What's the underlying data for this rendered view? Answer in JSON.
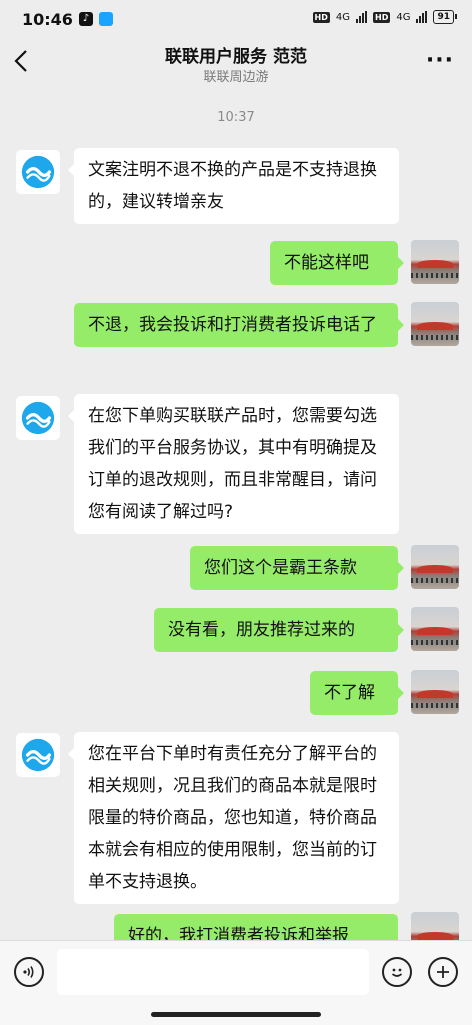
{
  "status_bar": {
    "time": "10:46",
    "battery": "91",
    "net1": "4G",
    "net2": "4G"
  },
  "header": {
    "title": "联联用户服务 范范",
    "subtitle": "联联周边游",
    "back_icon": "chevron-left-icon",
    "more_icon": "more-dots-icon"
  },
  "chat": {
    "timestamp": "10:37",
    "messages": [
      {
        "from": "service",
        "text": "文案注明不退不换的产品是不支持退换的，建议转增亲友"
      },
      {
        "from": "me",
        "text": "不能这样吧"
      },
      {
        "from": "me",
        "text": "不退，我会投诉和打消费者投诉电话了"
      },
      {
        "from": "service",
        "text": "在您下单购买联联产品时，您需要勾选我们的平台服务协议，其中有明确提及订单的退改规则，而且非常醒目，请问您有阅读了解过吗?"
      },
      {
        "from": "me",
        "text": "您们这个是霸王条款"
      },
      {
        "from": "me",
        "text": "没有看，朋友推荐过来的"
      },
      {
        "from": "me",
        "text": "不了解"
      },
      {
        "from": "service",
        "text": "您在平台下单时有责任充分了解平台的相关规则，况且我们的商品本就是限时限量的特价商品，您也知道，特价商品本就会有相应的使用限制，您当前的订单不支持退换。"
      },
      {
        "from": "me",
        "text": "好的，我打消费者投诉和举报"
      }
    ]
  },
  "input_bar": {
    "placeholder": "",
    "voice_icon": "voice-icon",
    "emoji_icon": "emoji-icon",
    "plus_icon": "plus-icon"
  },
  "colors": {
    "background": "#ededed",
    "my_bubble": "#95ec69",
    "service_bubble": "#ffffff"
  }
}
